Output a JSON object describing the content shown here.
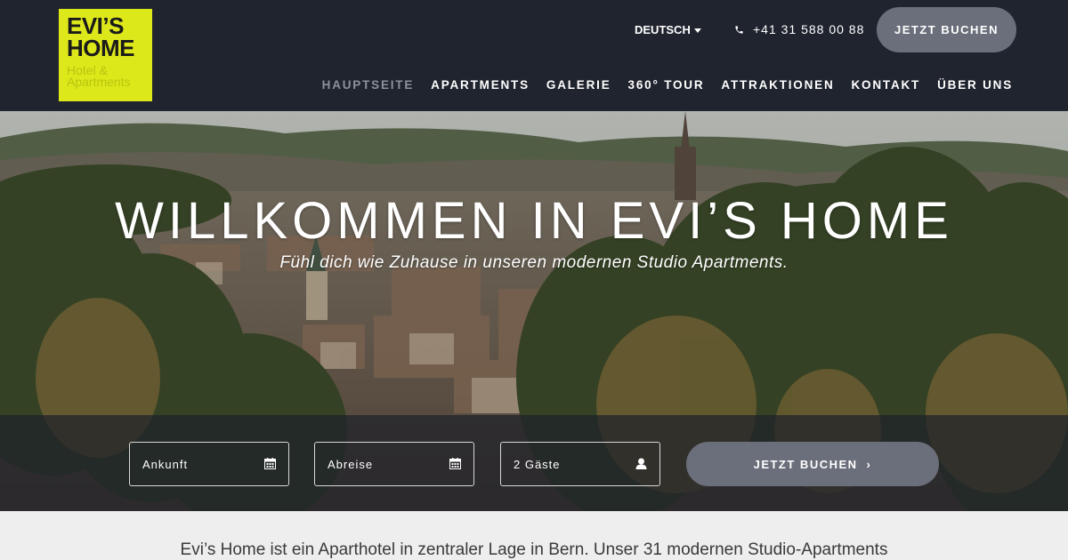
{
  "header": {
    "logo": {
      "title_line1": "EVI’S",
      "title_line2": "HOME",
      "sub_line1": "Hotel &",
      "sub_line2": "Apartments"
    },
    "language": "DEUTSCH",
    "phone": "+41 31 588 00 88",
    "book_label": "JETZT BUCHEN",
    "nav": [
      "HAUPTSEITE",
      "APARTMENTS",
      "GALERIE",
      "360° TOUR",
      "ATTRAKTIONEN",
      "KONTAKT",
      "ÜBER UNS"
    ]
  },
  "hero": {
    "title": "WILLKOMMEN IN EVI’S HOME",
    "subtitle": "Fühl dich wie Zuhause in unseren modernen Studio Apartments."
  },
  "booking": {
    "arrival": "Ankunft",
    "departure": "Abreise",
    "guests": "2 Gäste",
    "button": "JETZT BUCHEN",
    "button_arrow": "›"
  },
  "intro": {
    "text": "Evi’s Home ist ein Aparthotel in zentraler Lage in Bern. Unser 31 modernen Studio-Apartments"
  },
  "colors": {
    "header_bg": "#20242f",
    "logo_bg": "#dde81a",
    "button_bg": "#6b6f7b",
    "nav_active": "#8d919b"
  }
}
